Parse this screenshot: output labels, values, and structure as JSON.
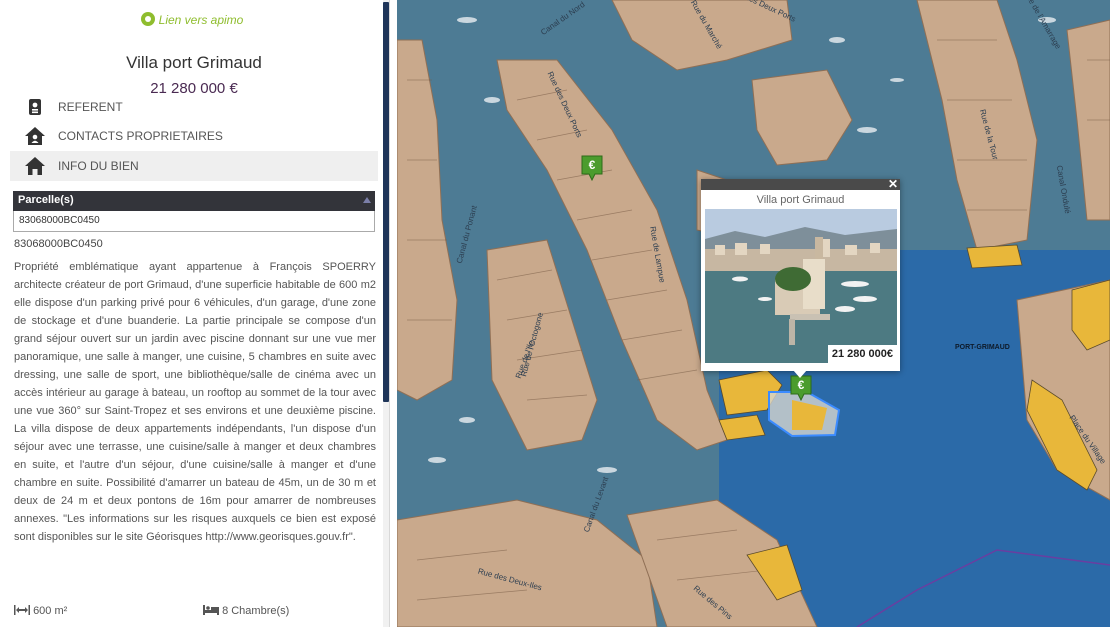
{
  "sidebar": {
    "apimo_link": "Lien vers apimo",
    "title": "Villa port Grimaud",
    "price": "21 280 000 €",
    "menu": {
      "referent": "REFERENT",
      "contacts": "CONTACTS PROPRIETAIRES",
      "info": "INFO DU BIEN"
    },
    "parcel": {
      "header": "Parcelle(s)",
      "selected": "83068000BC0450",
      "reference": "83068000BC0450"
    },
    "description": "Propriété emblématique ayant appartenue à François SPOERRY architecte créateur de port Grimaud, d'une superficie habitable de 600 m2 elle dispose d'un parking privé pour 6 véhicules, d'un garage, d'une zone de stockage et d'une buanderie. La partie principale se compose d'un grand séjour ouvert sur un jardin avec piscine donnant sur une vue mer panoramique, une salle à manger, une cuisine, 5 chambres en suite avec dressing, une salle de sport, une bibliothèque/salle de cinéma avec un accès intérieur au garage à bateau, un rooftop au sommet de la tour avec une vue 360° sur Saint-Tropez et ses environs et une deuxième piscine. La villa dispose de deux appartements indépendants, l'un dispose d'un séjour avec une terrasse, une cuisine/salle à manger et deux chambres en suite, et l'autre d'un séjour, d'une cuisine/salle à manger et d'une chambre en suite. Possibilité d'amarrer un bateau de 45m, un de 30 m et deux de 24 m et deux pontons de 16m pour amarrer de nombreuses annexes. \"Les informations sur les risques auxquels ce bien est exposé sont disponibles sur le site Géorisques http://www.georisques.gouv.fr\".",
    "features": {
      "surface": "600 m²",
      "rooms": "8 Chambre(s)"
    }
  },
  "map": {
    "street_labels": [
      "Canal du Nord",
      "Rue du Marché",
      "Rue des Deux Ports",
      "Rue de la Tour",
      "Canal Ondulé",
      "Canal du Ponant",
      "Rue de Lampue",
      "Rue de l'Octogone",
      "Canal du Levant",
      "Rue des Deux-Iles",
      "Rue des Pins",
      "Place du Village",
      "Rue de l'Amarrage",
      "Rue de l'Ile",
      "Rue des Deux Ports"
    ],
    "area_label": "PORT-GRIMAUD",
    "popup": {
      "title": "Villa port Grimaud",
      "price": "21 280 000€"
    },
    "marker_symbol": "€",
    "colors": {
      "sea": "#2b6aa8",
      "canal": "#4d7b94",
      "parcel_highlight": "#e8b73a",
      "selected_outline": "#3b8bff",
      "marker": "#4b9c2d",
      "commune_border": "#6a3ea1"
    }
  }
}
